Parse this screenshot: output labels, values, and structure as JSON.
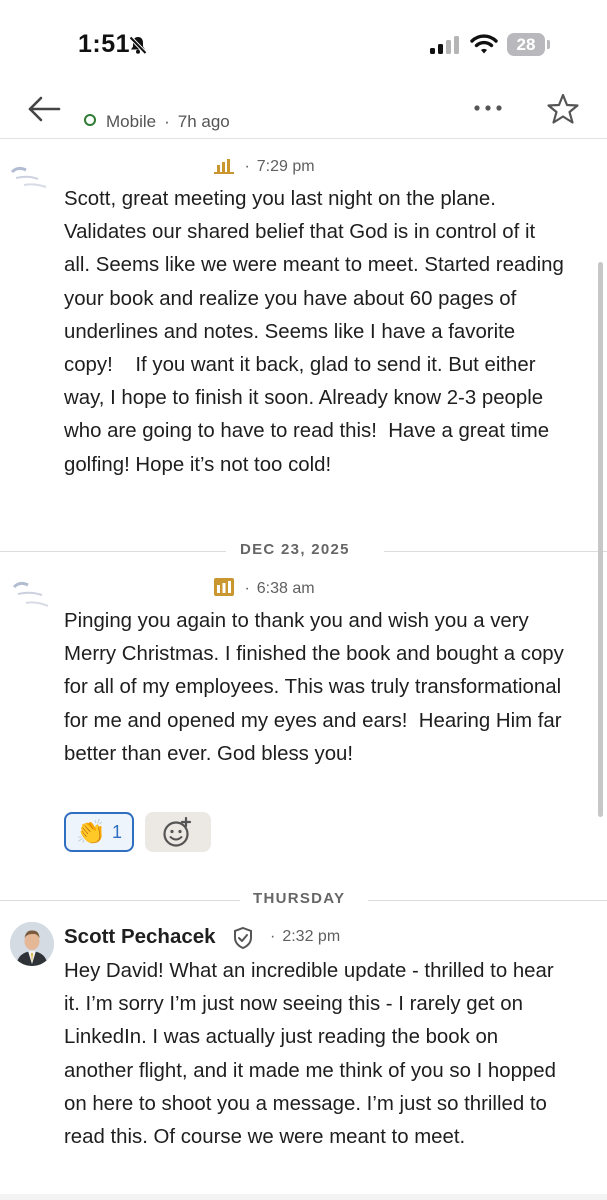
{
  "status_bar": {
    "time": "1:51",
    "battery": "28"
  },
  "header": {
    "presence": "Mobile",
    "last_active": "7h ago"
  },
  "messages": [
    {
      "time": "7:29 pm",
      "text": "Scott, great meeting you last night on the plane. Validates our shared belief that God is in control of it all. Seems like we were meant to meet. Started reading your book and realize you have about 60 pages of underlines and notes. Seems like I have a favorite copy!    If you want it back, glad to send it. But either way, I hope to finish it soon. Already know 2-3 people who are going to have to read this!  Have a great time golfing! Hope it’s not too cold!"
    },
    {
      "date_separator": "DEC 23, 2025",
      "time": "6:38 am",
      "text": "Pinging you again to thank you and wish you a very Merry Christmas. I finished the book and bought a copy for all of my employees. This was truly transformational for me and opened my eyes and ears!  Hearing Him far better than ever. God bless you!",
      "reaction_emoji": "👏",
      "reaction_count": "1"
    },
    {
      "date_separator": "THURSDAY",
      "sender": "Scott Pechacek",
      "time": "2:32 pm",
      "text": "Hey David! What an incredible update - thrilled to hear it. I’m sorry I’m just now seeing this - I rarely get on LinkedIn. I was actually just reading the book on another flight, and it made me think of you so I hopped on here to shoot you a message. I’m just so thrilled to read this. Of course we were meant to meet."
    }
  ],
  "icons": {
    "back": "arrow-left-icon",
    "more": "more-dots-icon",
    "star": "star-icon",
    "verified": "shield-check-icon",
    "add_reaction": "add-emoji-icon",
    "premium": "premium-badge-icon"
  },
  "colors": {
    "presence_green": "#2f7d32",
    "reaction_blue": "#2e6fbf",
    "premium_gold": "#c9962f"
  }
}
